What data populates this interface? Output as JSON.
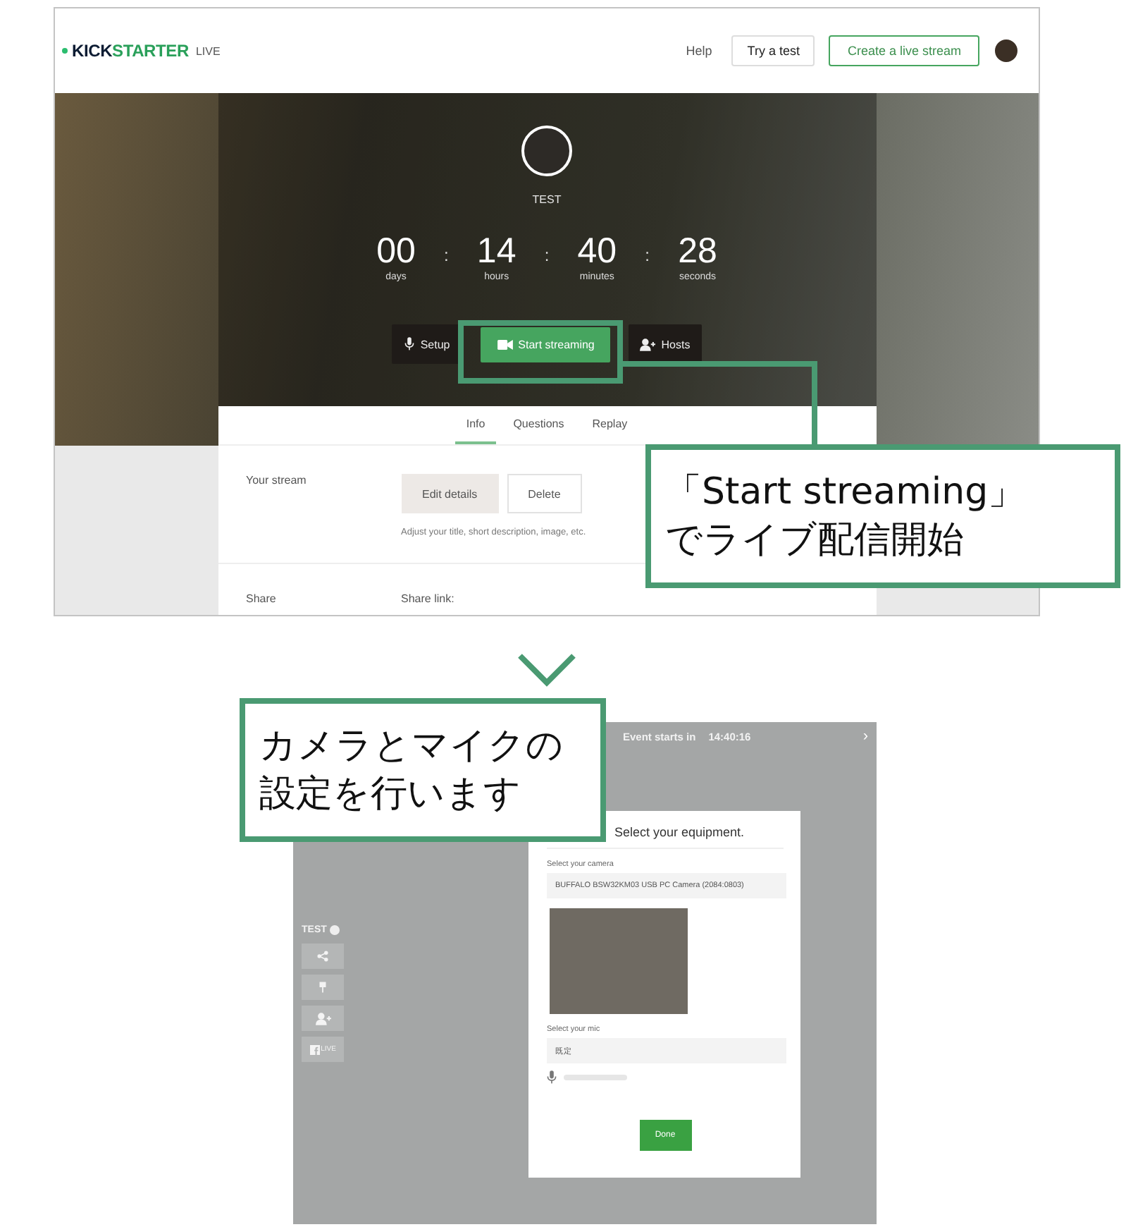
{
  "top_screenshot": {
    "logo": {
      "brand_dark": "KICK",
      "brand_green": "STARTER",
      "suffix": "LIVE"
    },
    "nav": {
      "help": "Help",
      "try_button": "Try a test",
      "create_button": "Create a live stream"
    },
    "host_name": "TEST",
    "countdown": [
      {
        "value": "00",
        "unit": "days"
      },
      {
        "value": "14",
        "unit": "hours"
      },
      {
        "value": "40",
        "unit": "minutes"
      },
      {
        "value": "28",
        "unit": "seconds"
      }
    ],
    "separators": [
      ":",
      ":",
      ":"
    ],
    "actions": [
      {
        "label": "Setup",
        "kind": "dark"
      },
      {
        "label": "Start streaming",
        "kind": "primary"
      },
      {
        "label": "Hosts",
        "kind": "dark"
      }
    ],
    "tabs": [
      {
        "label": "Info",
        "selected": true
      },
      {
        "label": "Questions",
        "selected": false
      },
      {
        "label": "Replay",
        "selected": false
      }
    ],
    "your_stream": {
      "label": "Your stream",
      "buttons": [
        {
          "label": "Edit details",
          "kind": "filled"
        },
        {
          "label": "Delete",
          "kind": "outline"
        }
      ],
      "hint": "Adjust your title, short description, image, etc."
    },
    "share": {
      "label": "Share",
      "link_label": "Share link:"
    }
  },
  "bottom_screenshot": {
    "event_label": "Event starts in",
    "event_time": "14:40:16",
    "next": "›",
    "stream_name": "TEST",
    "side_buttons": [
      {
        "kind": "share"
      },
      {
        "kind": "pin"
      },
      {
        "kind": "user"
      },
      {
        "kind": "facebook",
        "label": "LIVE"
      }
    ],
    "modal": {
      "title": "Select your equipment.",
      "camera_label": "Select your camera",
      "camera_value": "BUFFALO BSW32KM03 USB PC Camera (2084:0803)",
      "mic_label": "Select your mic",
      "mic_value": "既定",
      "done": "Done"
    }
  },
  "callouts": [
    {
      "lines": [
        "「Start streaming」",
        "でライブ配信開始"
      ]
    },
    {
      "lines": [
        "カメラとマイクの",
        "設定を行います"
      ]
    }
  ]
}
